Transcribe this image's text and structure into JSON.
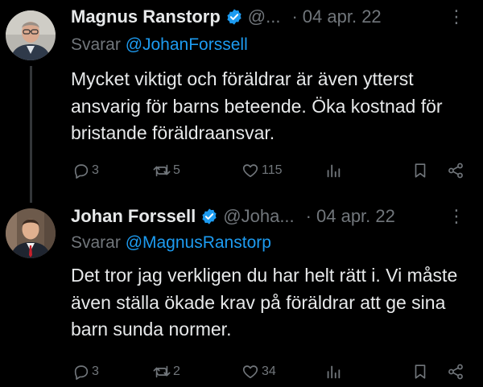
{
  "tweets": [
    {
      "name": "Magnus Ranstorp",
      "handle": "@...",
      "date": "04 apr. 22",
      "replying_prefix": "Svarar ",
      "replying_to": "@JohanForssell",
      "text": "Mycket viktigt och föräldrar är även ytterst ansvarig för barns beteende. Öka kostnad för bristande föräldraansvar.",
      "replies": "3",
      "reposts": "5",
      "likes": "115"
    },
    {
      "name": "Johan Forssell",
      "handle": "@Joha...",
      "date": "04 apr. 22",
      "replying_prefix": "Svarar ",
      "replying_to": "@MagnusRanstorp",
      "text": "Det tror jag verkligen du har helt rätt i. Vi måste även ställa ökade krav på föräldrar att ge sina barn sunda normer.",
      "replies": "3",
      "reposts": "2",
      "likes": "34"
    }
  ],
  "header": {
    "separator": "·",
    "more": "⋮"
  },
  "colors": {
    "background": "#000000",
    "text": "#e7e9ea",
    "muted": "#71767b",
    "link": "#1d9bf0",
    "verified": "#1d9bf0"
  },
  "icons": [
    "verified-badge-icon",
    "reply-icon",
    "repost-icon",
    "like-icon",
    "views-icon",
    "bookmark-icon",
    "share-icon",
    "more-icon"
  ]
}
